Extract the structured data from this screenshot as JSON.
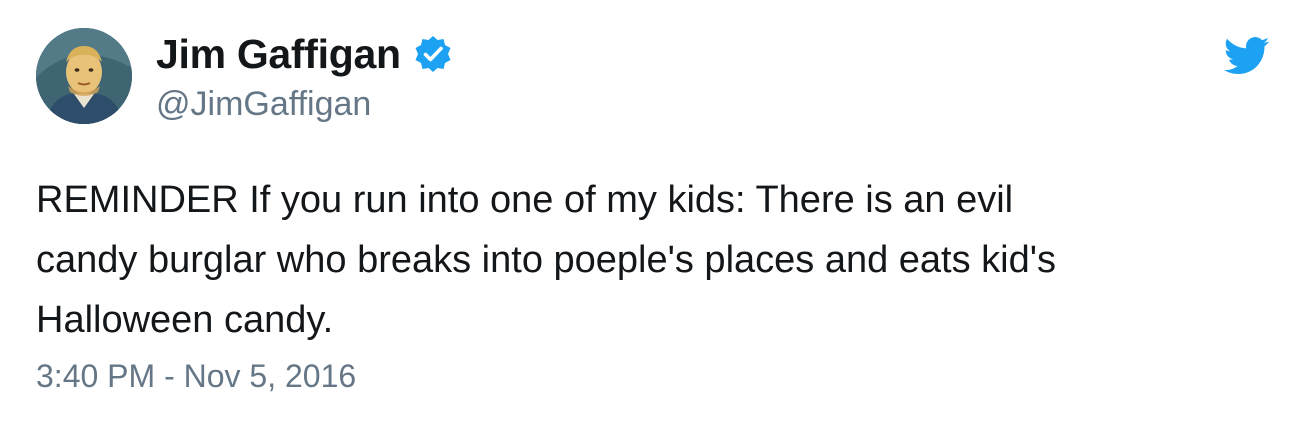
{
  "author": {
    "display_name": "Jim Gaffigan",
    "handle": "@JimGaffigan",
    "verified": true,
    "avatar_icon": "caricature-portrait-avatar"
  },
  "tweet": {
    "text_lines": [
      "REMINDER If you run into one of my kids: There is an evil",
      "candy burglar who breaks into poeple's places and eats kid's",
      "Halloween candy."
    ],
    "timestamp": "3:40 PM - Nov 5, 2016"
  },
  "icons": {
    "verified": "verified-badge-icon",
    "brand": "twitter-bird-icon"
  },
  "colors": {
    "text": "#14171a",
    "secondary_text": "#657786",
    "brand_blue": "#1da1f2",
    "background": "#ffffff"
  }
}
